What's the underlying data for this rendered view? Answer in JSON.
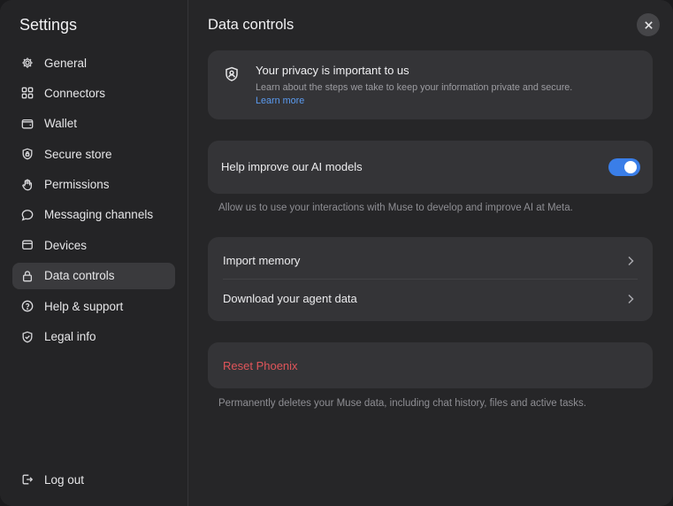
{
  "sidebar": {
    "title": "Settings",
    "items": [
      {
        "label": "General",
        "icon": "gear-icon"
      },
      {
        "label": "Connectors",
        "icon": "grid-icon"
      },
      {
        "label": "Wallet",
        "icon": "wallet-icon"
      },
      {
        "label": "Secure store",
        "icon": "shield-lock-icon"
      },
      {
        "label": "Permissions",
        "icon": "hand-icon"
      },
      {
        "label": "Messaging channels",
        "icon": "chat-bubble-icon"
      },
      {
        "label": "Devices",
        "icon": "device-icon"
      },
      {
        "label": "Data controls",
        "icon": "lock-icon",
        "active": true
      },
      {
        "label": "Help & support",
        "icon": "question-circle-icon"
      },
      {
        "label": "Legal info",
        "icon": "shield-check-icon"
      }
    ],
    "logout_label": "Log out"
  },
  "main": {
    "title": "Data controls",
    "privacy": {
      "title": "Your privacy is important to us",
      "description": "Learn about the steps we take to keep your information private and secure.",
      "link": "Learn more"
    },
    "improve": {
      "label": "Help improve our AI models",
      "enabled": true,
      "help": "Allow us to use your interactions with Muse to develop and improve AI at Meta."
    },
    "rows": [
      {
        "label": "Import memory"
      },
      {
        "label": "Download your agent data"
      }
    ],
    "reset": {
      "label": "Reset Phoenix",
      "help": "Permanently deletes your Muse data, including chat history, files and active tasks."
    }
  },
  "colors": {
    "accent": "#3a7ee8",
    "link": "#5b9bf0",
    "danger": "#e0555a"
  }
}
